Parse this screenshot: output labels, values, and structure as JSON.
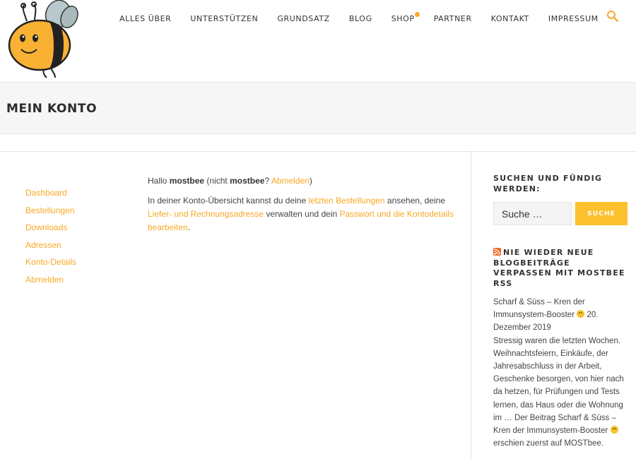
{
  "nav": {
    "items": [
      "ALLES ÜBER",
      "UNTERSTÜTZEN",
      "GRUNDSATZ",
      "BLOG",
      "SHOP",
      "PARTNER",
      "KONTAKT",
      "IMPRESSUM"
    ]
  },
  "page": {
    "title": "MEIN KONTO"
  },
  "account_nav": [
    "Dashboard",
    "Bestellungen",
    "Downloads",
    "Adressen",
    "Konto-Details",
    "Abmelden"
  ],
  "content": {
    "greeting_hello": "Hallo",
    "username": "mostbee",
    "greeting_not": "(nicht",
    "username2": "mostbee",
    "greeting_q": "?",
    "logout_link": "Abmelden",
    "greeting_close": ")",
    "intro_1": "In deiner Konto-Übersicht kannst du deine",
    "link_orders": "letzten Bestellungen",
    "intro_2": "ansehen, deine",
    "link_address": "Liefer- und Rechnungsadresse",
    "intro_3": "verwalten und dein",
    "link_password": "Passwort und die Kontodetails bearbeiten",
    "intro_4": "."
  },
  "sidebar": {
    "search_title": "SUCHEN UND FÜNDIG WERDEN:",
    "search_placeholder": "Suche …",
    "search_button": "SUCHE",
    "rss_title": "NIE WIEDER NEUE BLOGBEITRÄGE VERPASSEN MIT MOSTBEE RSS",
    "post_title": "Scharf & Süss – Kren der Immunsystem-Booster",
    "post_date": "20. Dezember 2019",
    "post_excerpt": "Stressig waren die letzten Wochen. Weihnachtsfeiern, Einkäufe, der Jahresabschluss in der Arbeit, Geschenke besorgen, von hier nach da hetzen, für Prüfungen und Tests lernen, das Haus oder die Wohnung im … Der Beitrag Scharf & Süss – Kren der Immunsystem-Booster",
    "post_footer": "erschien zuerst auf MOSTbee."
  },
  "colors": {
    "accent": "#f9a825",
    "button": "#fbc02d"
  }
}
